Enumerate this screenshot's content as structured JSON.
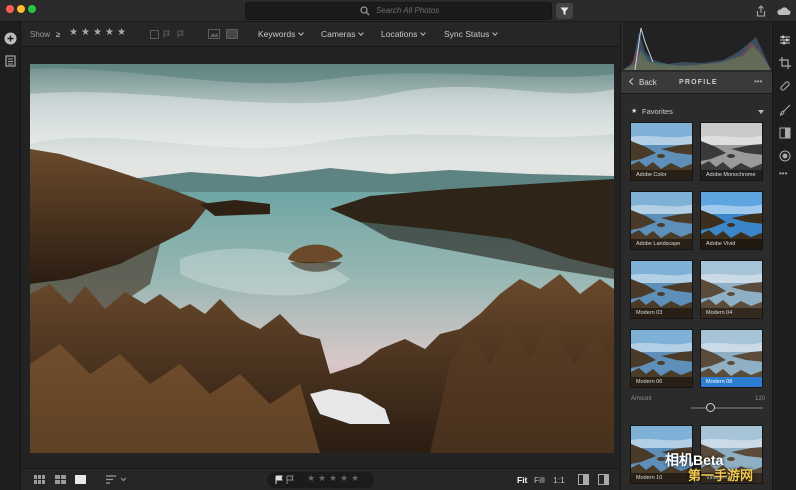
{
  "search": {
    "placeholder": "Search All Photos"
  },
  "filter_bar": {
    "show_label": "Show",
    "rating_op": "≥",
    "stars": [
      "★",
      "★",
      "★",
      "★",
      "★"
    ],
    "dropdowns": [
      "Keywords",
      "Cameras",
      "Locations",
      "Sync Status"
    ]
  },
  "right_panel": {
    "back_label": "Back",
    "header_title": "PROFILE",
    "more_label": "•••",
    "favorites_label": "Favorites",
    "profiles": [
      {
        "label": "Adobe Color",
        "style": "color",
        "selected": false
      },
      {
        "label": "Adobe Monochrome",
        "style": "mono",
        "selected": false
      },
      {
        "label": "Adobe Landscape",
        "style": "color",
        "selected": false
      },
      {
        "label": "Adobe Vivid",
        "style": "vivid",
        "selected": false
      },
      {
        "label": "Modern 03",
        "style": "color",
        "selected": false
      },
      {
        "label": "Modern 04",
        "style": "faded",
        "selected": false
      },
      {
        "label": "Modern 06",
        "style": "color",
        "selected": false
      },
      {
        "label": "Modern 08",
        "style": "faded",
        "selected": true
      },
      {
        "label": "Modern 10",
        "style": "color",
        "selected": false
      },
      {
        "label": "Vintage 02",
        "style": "faded",
        "selected": false
      }
    ],
    "amount_label": "Amount",
    "amount_value": "120",
    "amount_fraction": 0.6
  },
  "bottom_bar": {
    "fit_label": "Fit",
    "fill_label": "Fill",
    "ratio_label": "1:1",
    "rating_stars": [
      "★",
      "★",
      "★",
      "★",
      "★"
    ]
  },
  "watermark": {
    "line1": "相机Beta",
    "line2": "第一手游网"
  },
  "colors": {
    "accent": "#2d7dd2",
    "bg": "#232323",
    "panel": "#2b2b2b"
  }
}
